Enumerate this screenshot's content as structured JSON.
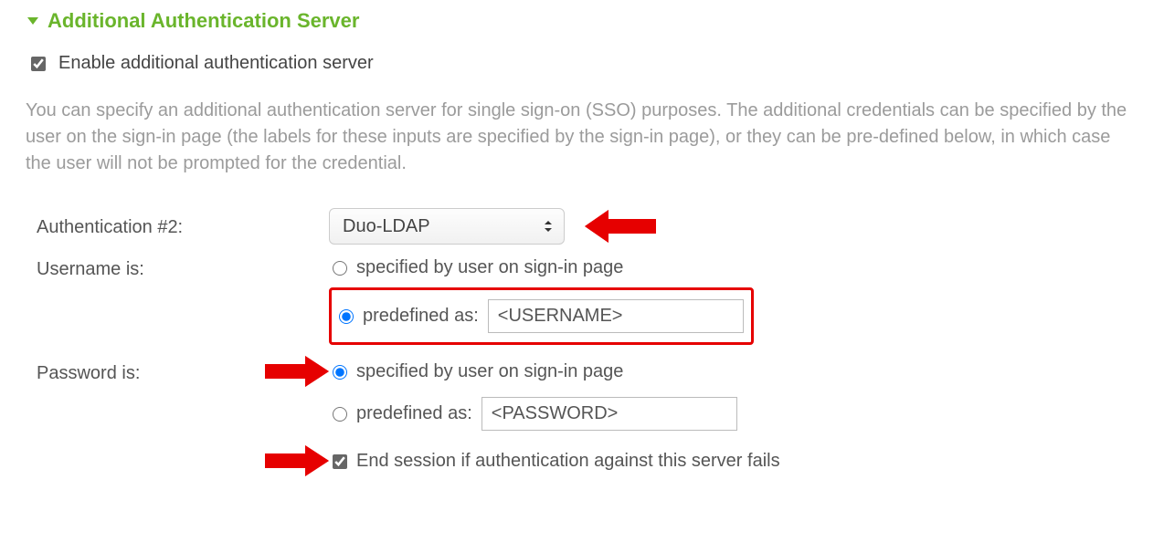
{
  "section": {
    "title": "Additional Authentication Server"
  },
  "enable": {
    "label": "Enable additional authentication server",
    "checked": true
  },
  "description": "You can specify an additional authentication server for single sign-on (SSO) purposes. The additional credentials can be specified by the user on the sign-in page (the labels for these inputs are specified by the sign-in page), or they can be pre-defined below, in which case the user will not be prompted for the credential.",
  "auth_select": {
    "label": "Authentication #2:",
    "value": "Duo-LDAP"
  },
  "username": {
    "label": "Username is:",
    "opt_specified": "specified by user on sign-in page",
    "opt_predefined": "predefined as:",
    "predefined_value": "<USERNAME>",
    "selected": "predefined"
  },
  "password": {
    "label": "Password is:",
    "opt_specified": "specified by user on sign-in page",
    "opt_predefined": "predefined as:",
    "predefined_value": "<PASSWORD>",
    "selected": "specified"
  },
  "end_session": {
    "label": "End session if authentication against this server fails",
    "checked": true
  }
}
